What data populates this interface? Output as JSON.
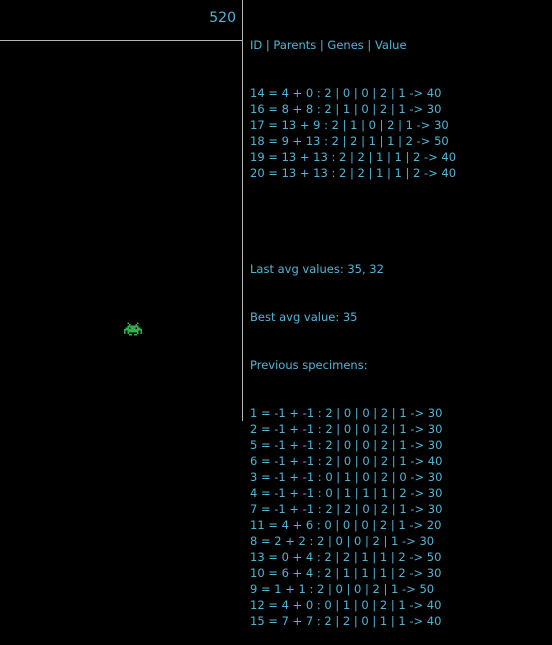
{
  "game": {
    "score": "520",
    "colors": {
      "text": "#4fb6d8",
      "invader": "#2fb24a",
      "background": "#000000",
      "lines": "#b5b5b5"
    },
    "invader_icon": "space-invader-icon"
  },
  "panel": {
    "header": "ID | Parents | Genes | Value",
    "current": [
      "14 = 4 + 0 : 2 | 0 | 0 | 2 | 1 -> 40",
      "16 = 8 + 8 : 2 | 1 | 0 | 2 | 1 -> 30",
      "17 = 13 + 9 : 2 | 1 | 0 | 2 | 1 -> 30",
      "18 = 9 + 13 : 2 | 2 | 1 | 1 | 2 -> 50",
      "19 = 13 + 13 : 2 | 2 | 1 | 1 | 2 -> 40",
      "20 = 13 + 13 : 2 | 2 | 1 | 1 | 2 -> 40"
    ],
    "last_avg": "Last avg values: 35, 32",
    "best_avg": "Best avg value: 35",
    "previous_title": "Previous specimens:",
    "previous": [
      "1 = -1 + -1 : 2 | 0 | 0 | 2 | 1 -> 30",
      "2 = -1 + -1 : 2 | 0 | 0 | 2 | 1 -> 30",
      "5 = -1 + -1 : 2 | 0 | 0 | 2 | 1 -> 30",
      "6 = -1 + -1 : 2 | 0 | 0 | 2 | 1 -> 40",
      "3 = -1 + -1 : 0 | 1 | 0 | 2 | 0 -> 30",
      "4 = -1 + -1 : 0 | 1 | 1 | 1 | 2 -> 30",
      "7 = -1 + -1 : 2 | 2 | 0 | 2 | 1 -> 30",
      "11 = 4 + 6 : 0 | 0 | 0 | 2 | 1 -> 20",
      "8 = 2 + 2 : 2 | 0 | 0 | 2 | 1 -> 30",
      "13 = 0 + 4 : 2 | 2 | 1 | 1 | 2 -> 50",
      "10 = 6 + 4 : 2 | 1 | 1 | 1 | 2 -> 30",
      "9 = 1 + 1 : 2 | 0 | 0 | 2 | 1 -> 50",
      "12 = 4 + 0 : 0 | 1 | 0 | 2 | 1 -> 40",
      "15 = 7 + 7 : 2 | 2 | 0 | 1 | 1 -> 40"
    ]
  }
}
